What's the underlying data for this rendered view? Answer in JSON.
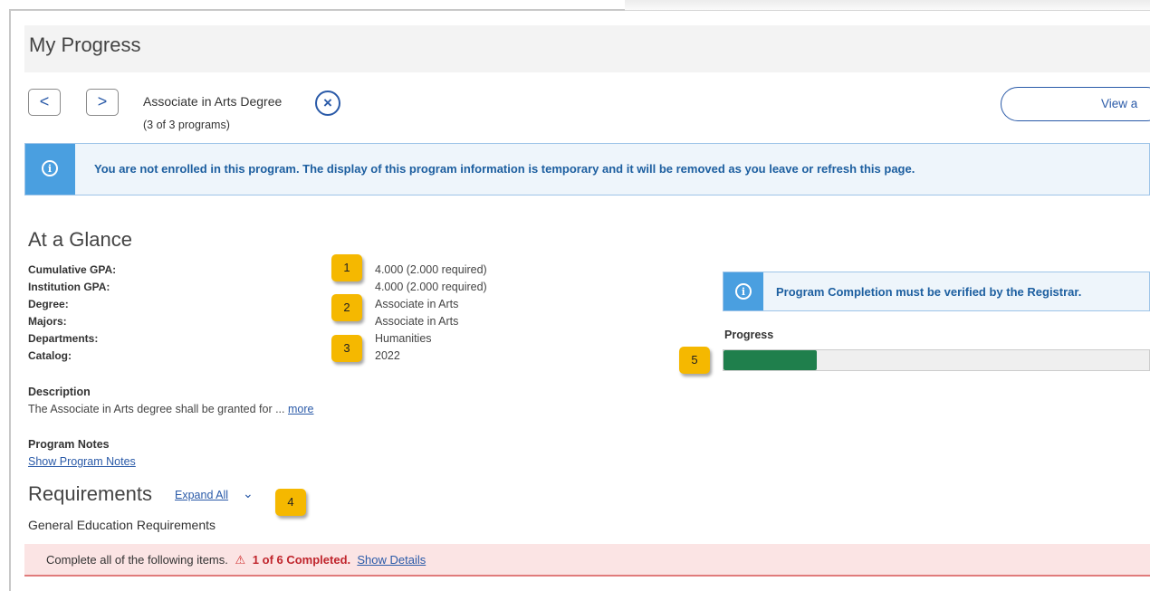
{
  "header": {
    "title": "My Progress"
  },
  "program_nav": {
    "prev_label": "<",
    "next_label": ">",
    "program_name": "Associate in Arts Degree",
    "close_label": "×",
    "program_count": "(3 of 3 programs)",
    "view_button_label": "View a"
  },
  "info_banner": {
    "icon": "info-icon",
    "text": "You are not enrolled in this program. The display of this program information is temporary and it will be removed as you leave or refresh this page."
  },
  "glance": {
    "title": "At a Glance",
    "rows": [
      {
        "label": "Cumulative GPA:",
        "value": "4.000 (2.000 required)"
      },
      {
        "label": "Institution GPA:",
        "value": "4.000 (2.000 required)"
      },
      {
        "label": "Degree:",
        "value": "Associate in Arts"
      },
      {
        "label": "Majors:",
        "value": "Associate in Arts"
      },
      {
        "label": "Departments:",
        "value": "Humanities"
      },
      {
        "label": "Catalog:",
        "value": "2022"
      }
    ]
  },
  "callouts": [
    "1",
    "2",
    "3",
    "4",
    "5"
  ],
  "registrar_notice": {
    "icon": "info-icon",
    "text": "Program Completion must be verified by the Registrar."
  },
  "progress": {
    "label": "Progress",
    "fraction": 0.22,
    "fill_color": "#1f7f4c"
  },
  "description": {
    "label": "Description",
    "text": "The Associate in Arts degree shall be granted for ... ",
    "more_link": "more"
  },
  "program_notes": {
    "label": "Program Notes",
    "link": "Show Program Notes"
  },
  "requirements": {
    "title": "Requirements",
    "expand_all": "Expand All",
    "group_title": "General Education Requirements",
    "status_prefix": "Complete all of the following items.",
    "status_count": "1 of 6 Completed.",
    "show_details": "Show Details"
  },
  "colors": {
    "accent": "#2a5aa8",
    "info_bg": "#4a9fe0",
    "warn": "#c0262d",
    "callout": "#f5b800"
  }
}
